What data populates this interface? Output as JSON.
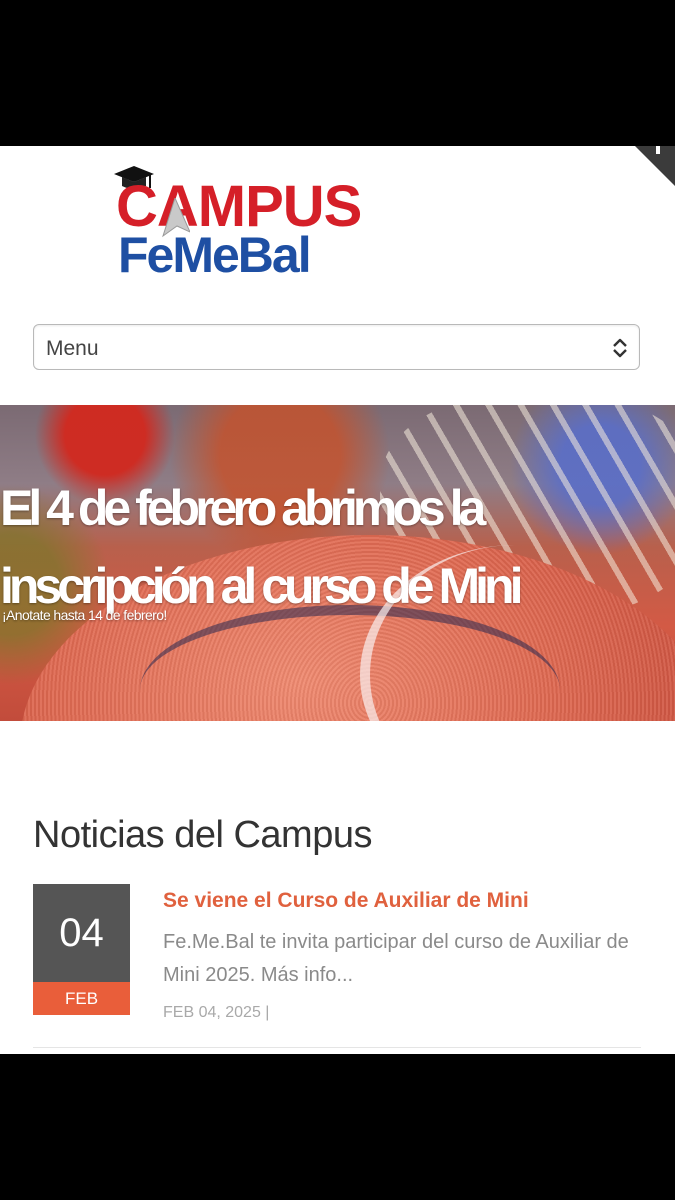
{
  "logo": {
    "line1": "CAMPUS",
    "line2": "FeMeBal"
  },
  "menu": {
    "label": "Menu"
  },
  "hero": {
    "title": "El 4 de febrero abrimos la inscripción al curso de Mini",
    "subtitle": "¡Anotate hasta 14 de febrero!"
  },
  "news": {
    "heading": "Noticias del Campus",
    "items": [
      {
        "day": "04",
        "month": "FEB",
        "title": "Se viene el Curso de Auxiliar de Mini",
        "excerpt": "Fe.Me.Bal te invita participar del curso de Auxiliar de Mini 2025. Más info...",
        "meta": "FEB 04, 2025 |"
      }
    ]
  },
  "colors": {
    "brand_red": "#d51f28",
    "brand_blue": "#1e4fa3",
    "accent_orange": "#e95e3a",
    "date_gray": "#555555"
  },
  "icons": [
    "graduation-cap-icon",
    "arrow-cursor-icon",
    "select-chevron-icon"
  ]
}
